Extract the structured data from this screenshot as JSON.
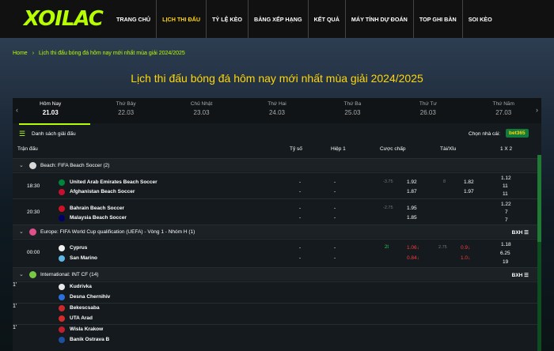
{
  "logo": "XOILAC",
  "nav": [
    "TRANG CHỦ",
    "LỊCH THI ĐẤU",
    "TỶ LỆ KÈO",
    "BẢNG XẾP HẠNG",
    "KẾT QUẢ",
    "MÁY TÍNH DỰ ĐOÁN",
    "TOP GHI BÀN",
    "SOI KÈO"
  ],
  "breadcrumb": {
    "home": "Home",
    "sep": "›",
    "current": "Lịch thi đấu bóng đá hôm nay mới nhất mùa giải 2024/2025"
  },
  "page_title": "Lịch thi đấu bóng đá hôm nay mới nhất mùa giải 2024/2025",
  "days": [
    {
      "name": "Hôm Nay",
      "date": "21.03"
    },
    {
      "name": "Thứ Bảy",
      "date": "22.03"
    },
    {
      "name": "Chủ Nhật",
      "date": "23.03"
    },
    {
      "name": "Thứ Hai",
      "date": "24.03"
    },
    {
      "name": "Thứ Ba",
      "date": "25.03"
    },
    {
      "name": "Thứ Tư",
      "date": "26.03"
    },
    {
      "name": "Thứ Năm",
      "date": "27.03"
    }
  ],
  "tools": {
    "league_list": "Danh sách giải đấu",
    "provider_label": "Chọn nhà cái:",
    "provider": "bet365"
  },
  "columns": {
    "match": "Trận đấu",
    "score": "Tỷ số",
    "half": "Hiệp 1",
    "handicap": "Cược chấp",
    "ou": "Tài/Xỉu",
    "x12": "1 X 2"
  },
  "leagues": [
    {
      "name": "Beach: FIFA Beach Soccer (2)",
      "bxh": ""
    },
    {
      "name": "Europe: FIFA World Cup qualification (UEFA) - Vòng 1 - Nhóm H (1)",
      "bxh": "BXH ☰"
    },
    {
      "name": "International: INT CF (14)",
      "bxh": "BXH ☰"
    }
  ],
  "matches": [
    {
      "time": "18:30",
      "home": "United Arab Emirates Beach Soccer",
      "away": "Afghanistan Beach Soccer",
      "score": [
        "-",
        "-"
      ],
      "half": [
        "-",
        "-"
      ],
      "hc_line": "-3.75",
      "hc": [
        "1.92",
        "1.87"
      ],
      "ou_line": "8",
      "ou": [
        "1.82",
        "1.97"
      ],
      "x12": [
        "1.12",
        "11",
        "11"
      ]
    },
    {
      "time": "20:30",
      "home": "Bahrain Beach Soccer",
      "away": "Malaysia Beach Soccer",
      "score": [
        "-",
        "-"
      ],
      "half": [
        "-",
        "-"
      ],
      "hc_line": "-2.75",
      "hc": [
        "1.95",
        "1.85"
      ],
      "ou_line": "",
      "ou": [
        "",
        ""
      ],
      "x12": [
        "1.22",
        "7",
        "7"
      ]
    },
    {
      "time": "00:00",
      "home": "Cyprus",
      "away": "San Marino",
      "score": [
        "-",
        "-"
      ],
      "half": [
        "-",
        "-"
      ],
      "hc_line": "2t",
      "hc": [
        "1.06↓",
        "0.84↓"
      ],
      "ou_line": "2.75",
      "ou": [
        "0.9↓",
        "1.0↓"
      ],
      "x12": [
        "1.18",
        "6.25",
        "19"
      ]
    }
  ],
  "intcf": [
    {
      "live": "1'",
      "home": "Kudrivka",
      "away": "Desna Chernihiv"
    },
    {
      "live": "1'",
      "home": "Bekescsaba",
      "away": "UTA Arad"
    },
    {
      "live": "1'",
      "home": "Wisla Krakow",
      "away": "Banik Ostrava B"
    }
  ],
  "colors": {
    "accent": "#b7ff00",
    "title": "#ffd60a",
    "down": "#ff3b3b",
    "up": "#33cc55"
  }
}
